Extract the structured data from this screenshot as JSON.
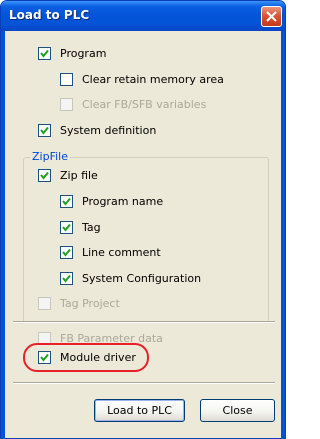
{
  "dialog": {
    "title": "Load to PLC"
  },
  "options": [
    {
      "label": "Program",
      "checked": true,
      "disabled": false
    },
    {
      "label": "Clear retain memory area",
      "checked": false,
      "disabled": false
    },
    {
      "label": "Clear FB/SFB variables",
      "checked": false,
      "disabled": true
    },
    {
      "label": "System definition",
      "checked": true,
      "disabled": false
    }
  ],
  "zipfile": {
    "group_label": "ZipFile",
    "zip_file": {
      "label": "Zip file",
      "checked": true
    },
    "items": [
      {
        "label": "Program name",
        "checked": true
      },
      {
        "label": "Tag",
        "checked": true
      },
      {
        "label": "Line comment",
        "checked": true
      },
      {
        "label": "System Configuration",
        "checked": true
      }
    ],
    "tag_project": {
      "label": "Tag Project",
      "checked": false,
      "disabled": true
    }
  },
  "fb_parameter": {
    "label": "FB Parameter data",
    "checked": false,
    "disabled": true
  },
  "module_driver": {
    "label": "Module driver",
    "checked": true
  },
  "buttons": {
    "load_label": "Load to PLC",
    "close_label": "Close"
  },
  "colors": {
    "title_bar": "#0553d7",
    "group_label": "#0046d5",
    "highlight": "#e8202a"
  }
}
